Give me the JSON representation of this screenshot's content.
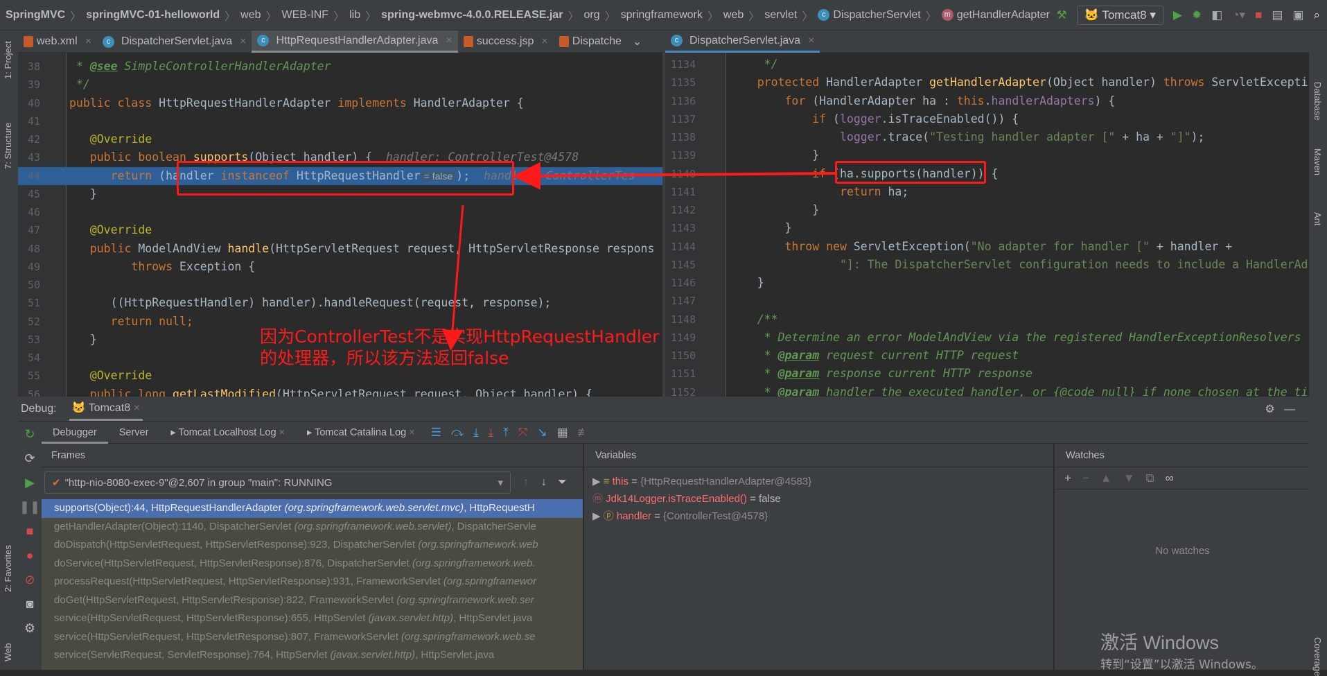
{
  "breadcrumb": [
    "SpringMVC",
    "springMVC-01-helloworld",
    "web",
    "WEB-INF",
    "lib",
    "spring-webmvc-4.0.0.RELEASE.jar",
    "org",
    "springframework",
    "web",
    "servlet",
    "DispatcherServlet",
    "getHandlerAdapter"
  ],
  "run_config": "Tomcat8",
  "left_tabs": [
    {
      "label": "web.xml"
    },
    {
      "label": "DispatcherServlet.java"
    },
    {
      "label": "HttpRequestHandlerAdapter.java",
      "active": true
    },
    {
      "label": "success.jsp"
    },
    {
      "label": "Dispatche"
    }
  ],
  "right_tabs": [
    {
      "label": "DispatcherServlet.java",
      "active": true
    }
  ],
  "left_code": [
    {
      "n": "38",
      "t": [
        [
          " * ",
          "cm"
        ],
        [
          "@see",
          "tg"
        ],
        [
          " SimpleControllerHandlerAdapter",
          "cm"
        ]
      ]
    },
    {
      "n": "39",
      "t": [
        [
          " */",
          "cm"
        ]
      ]
    },
    {
      "n": "40",
      "t": [
        [
          "public class ",
          "kw"
        ],
        [
          "HttpRequestHandlerAdapter ",
          "df"
        ],
        [
          "implements ",
          "kw"
        ],
        [
          "HandlerAdapter {",
          "df"
        ]
      ]
    },
    {
      "n": "41",
      "t": []
    },
    {
      "n": "42",
      "t": [
        [
          "   @Override",
          "an"
        ]
      ]
    },
    {
      "n": "43",
      "t": [
        [
          "   public boolean ",
          "kw"
        ],
        [
          "supports",
          "fn"
        ],
        [
          "(Object handler) {  ",
          "df"
        ],
        [
          "handler: ControllerTest@4578",
          "ht"
        ]
      ]
    },
    {
      "n": "44",
      "hl": true,
      "t": [
        [
          "      return ",
          "kw"
        ],
        [
          "(handler ",
          "df"
        ],
        [
          "instanceof ",
          "kw"
        ],
        [
          "HttpRequestHandler",
          "df"
        ],
        [
          "= false",
          "iv"
        ],
        [
          ");  ",
          "df"
        ],
        [
          "handler: ControllerTes",
          "ht"
        ]
      ]
    },
    {
      "n": "45",
      "t": [
        [
          "   }",
          "df"
        ]
      ]
    },
    {
      "n": "46",
      "t": []
    },
    {
      "n": "47",
      "t": [
        [
          "   @Override",
          "an"
        ]
      ]
    },
    {
      "n": "48",
      "t": [
        [
          "   public ",
          "kw"
        ],
        [
          "ModelAndView ",
          "df"
        ],
        [
          "handle",
          "fn"
        ],
        [
          "(HttpServletRequest request, HttpServletResponse respons",
          "df"
        ]
      ]
    },
    {
      "n": "49",
      "t": [
        [
          "         throws ",
          "kw"
        ],
        [
          "Exception {",
          "df"
        ]
      ]
    },
    {
      "n": "50",
      "t": []
    },
    {
      "n": "51",
      "t": [
        [
          "      ((HttpRequestHandler) handler).handleRequest(request, response);",
          "df"
        ]
      ]
    },
    {
      "n": "52",
      "t": [
        [
          "      return null",
          "kw"
        ],
        [
          ";",
          "kw"
        ]
      ]
    },
    {
      "n": "53",
      "t": [
        [
          "   }",
          "df"
        ]
      ]
    },
    {
      "n": "54",
      "t": []
    },
    {
      "n": "55",
      "t": [
        [
          "   @Override",
          "an"
        ]
      ]
    },
    {
      "n": "56",
      "t": [
        [
          "   public long ",
          "kw"
        ],
        [
          "getLastModified",
          "fn"
        ],
        [
          "(HttpServletRequest request, Object handler) {",
          "df"
        ]
      ]
    }
  ],
  "right_code": [
    {
      "n": "1134",
      "t": [
        [
          "     */",
          "cm"
        ]
      ]
    },
    {
      "n": "1135",
      "t": [
        [
          "    protected ",
          "kw"
        ],
        [
          "HandlerAdapter ",
          "df"
        ],
        [
          "getHandlerAdapter",
          "fn"
        ],
        [
          "(Object handler) ",
          "df"
        ],
        [
          "throws ",
          "kw"
        ],
        [
          "ServletExcepti",
          "df"
        ]
      ]
    },
    {
      "n": "1136",
      "t": [
        [
          "        for ",
          "kw"
        ],
        [
          "(HandlerAdapter ha : ",
          "df"
        ],
        [
          "this",
          "kw"
        ],
        [
          ".",
          "df"
        ],
        [
          "handlerAdapters",
          "fd"
        ],
        [
          ") {",
          "df"
        ]
      ]
    },
    {
      "n": "1137",
      "t": [
        [
          "            if ",
          "kw"
        ],
        [
          "(",
          "df"
        ],
        [
          "logger",
          "fd"
        ],
        [
          ".isTraceEnabled()) {",
          "df"
        ]
      ]
    },
    {
      "n": "1138",
      "t": [
        [
          "                ",
          "df"
        ],
        [
          "logger",
          "fd"
        ],
        [
          ".trace(",
          "df"
        ],
        [
          "\"Testing handler adapter [\"",
          "st"
        ],
        [
          " + ha + ",
          "df"
        ],
        [
          "\"]\"",
          "st"
        ],
        [
          ");",
          "df"
        ]
      ]
    },
    {
      "n": "1139",
      "t": [
        [
          "            }",
          "df"
        ]
      ]
    },
    {
      "n": "1140",
      "t": [
        [
          "            if ",
          "kw"
        ],
        [
          "(ha.supports(handler)) {",
          "df"
        ]
      ]
    },
    {
      "n": "1141",
      "t": [
        [
          "                return ",
          "kw"
        ],
        [
          "ha;",
          "df"
        ]
      ]
    },
    {
      "n": "1142",
      "t": [
        [
          "            }",
          "df"
        ]
      ]
    },
    {
      "n": "1143",
      "t": [
        [
          "        }",
          "df"
        ]
      ]
    },
    {
      "n": "1144",
      "t": [
        [
          "        throw new ",
          "kw"
        ],
        [
          "ServletException(",
          "df"
        ],
        [
          "\"No adapter for handler [\"",
          "st"
        ],
        [
          " + handler +",
          "df"
        ]
      ]
    },
    {
      "n": "1145",
      "t": [
        [
          "                ",
          "df"
        ],
        [
          "\"]: The DispatcherServlet configuration needs to include a HandlerAd",
          "st"
        ]
      ]
    },
    {
      "n": "1146",
      "t": [
        [
          "    }",
          "df"
        ]
      ]
    },
    {
      "n": "1147",
      "t": []
    },
    {
      "n": "1148",
      "t": [
        [
          "    /**",
          "cm"
        ]
      ]
    },
    {
      "n": "1149",
      "t": [
        [
          "     * Determine an error ModelAndView via the registered HandlerExceptionResolvers",
          "cm"
        ]
      ]
    },
    {
      "n": "1150",
      "t": [
        [
          "     * ",
          "cm"
        ],
        [
          "@param",
          "tg"
        ],
        [
          " request current HTTP request",
          "cm"
        ]
      ]
    },
    {
      "n": "1151",
      "t": [
        [
          "     * ",
          "cm"
        ],
        [
          "@param",
          "tg"
        ],
        [
          " response current HTTP response",
          "cm"
        ]
      ]
    },
    {
      "n": "1152",
      "t": [
        [
          "     * ",
          "cm"
        ],
        [
          "@param",
          "tg"
        ],
        [
          " handler the executed handler, or {@code null} if none chosen at the ti",
          "cm"
        ]
      ]
    }
  ],
  "annotation": {
    "line1": "因为ControllerTest不是实现HttpRequestHandler",
    "line2": "的处理器，所以该方法返回false",
    "color": "#ff1a1a"
  },
  "debug": {
    "label": "Debug:",
    "session": "Tomcat8",
    "tabs": [
      "Debugger",
      "Server",
      "Tomcat Localhost Log",
      "Tomcat Catalina Log"
    ],
    "frames_title": "Frames",
    "variables_title": "Variables",
    "watches_title": "Watches",
    "thread": "\"http-nio-8080-exec-9\"@2,607 in group \"main\": RUNNING",
    "frames": [
      [
        "supports(Object):44, HttpRequestHandlerAdapter ",
        "(org.springframework.web.servlet.mvc)",
        ", HttpRequestH"
      ],
      [
        "getHandlerAdapter(Object):1140, DispatcherServlet ",
        "(org.springframework.web.servlet)",
        ", DispatcherServle"
      ],
      [
        "doDispatch(HttpServletRequest, HttpServletResponse):923, DispatcherServlet ",
        "(org.springframework.web",
        ""
      ],
      [
        "doService(HttpServletRequest, HttpServletResponse):876, DispatcherServlet ",
        "(org.springframework.web.",
        ""
      ],
      [
        "processRequest(HttpServletRequest, HttpServletResponse):931, FrameworkServlet ",
        "(org.springframewor",
        ""
      ],
      [
        "doGet(HttpServletRequest, HttpServletResponse):822, FrameworkServlet ",
        "(org.springframework.web.ser",
        ""
      ],
      [
        "service(HttpServletRequest, HttpServletResponse):655, HttpServlet ",
        "(javax.servlet.http)",
        ", HttpServlet.java"
      ],
      [
        "service(HttpServletRequest, HttpServletResponse):807, FrameworkServlet ",
        "(org.springframework.web.se",
        ""
      ],
      [
        "service(ServletRequest, ServletResponse):764, HttpServlet ",
        "(javax.servlet.http)",
        ", HttpServlet.java"
      ]
    ],
    "variables": [
      {
        "name": "this",
        "eq": " = ",
        "value": "{HttpRequestHandlerAdapter@4583}",
        "icon": "field-icon"
      },
      {
        "name": "Jdk14Logger.isTraceEnabled()",
        "eq": " = ",
        "value": "false",
        "icon": "method-watch-icon"
      },
      {
        "name": "handler",
        "eq": " = ",
        "value": "{ControllerTest@4578}",
        "icon": "parameter-icon"
      }
    ],
    "no_watches": "No watches"
  },
  "side_left": [
    "1: Project",
    "7: Structure",
    "2: Favorites",
    "Web"
  ],
  "side_right": [
    "Database",
    "Maven",
    "Ant",
    "Coverage"
  ],
  "watermark": {
    "title": "激活 Windows",
    "subtitle": "转到“设置”以激活 Windows。"
  }
}
